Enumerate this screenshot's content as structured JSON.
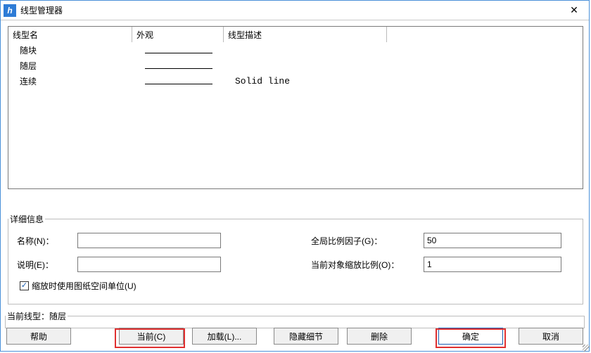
{
  "window": {
    "title": "线型管理器",
    "icon_glyph": "h"
  },
  "list": {
    "headers": {
      "name": "线型名",
      "look": "外观",
      "desc": "线型描述"
    },
    "rows": [
      {
        "name": "随块",
        "desc": ""
      },
      {
        "name": "随层",
        "desc": ""
      },
      {
        "name": "连续",
        "desc": "Solid line"
      }
    ]
  },
  "details": {
    "legend": "详细信息",
    "name_label": "名称(N)：",
    "name_value": "",
    "global_scale_label": "全局比例因子(G)：",
    "global_scale_value": "50",
    "desc_label": "说明(E)：",
    "desc_value": "",
    "current_scale_label": "当前对象缩放比例(O)：",
    "current_scale_value": "1",
    "paperspace_checkbox_label": "缩放时使用图纸空间单位(U)",
    "paperspace_checkbox_glyph": "✓"
  },
  "current_linetype": {
    "label_prefix": "当前线型：",
    "value": "随层"
  },
  "buttons": {
    "help": "帮助",
    "current": "当前(C)",
    "load": "加载(L)...",
    "hide_details": "隐藏细节",
    "delete": "删除",
    "ok": "确定",
    "cancel": "取消"
  }
}
